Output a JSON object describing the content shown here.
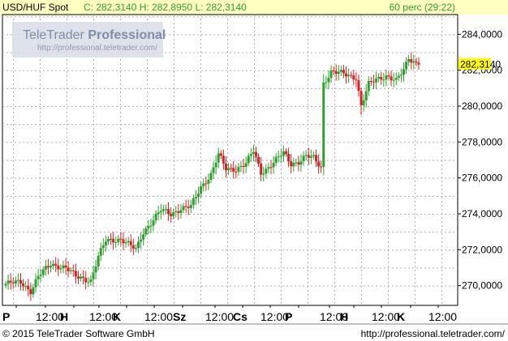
{
  "header": {
    "symbol": "USD/HUF Spot",
    "ohlc_text": "C: 282,3140 H: 282,8950 L: 282,3140",
    "interval": "60 perc (29:22)",
    "colors": {
      "background": "#ffffc0",
      "ohlc": "#2ea02e",
      "symbol": "#000000"
    }
  },
  "logo": {
    "name_plain": "TeleTrader",
    "name_bold": "Professional",
    "url": "http://professional.teletrader.com/"
  },
  "footer": {
    "copyright": "© 2015 TeleTrader Software GmbH",
    "url": "http://professional.teletrader.com/"
  },
  "chart_data": {
    "type": "candlestick",
    "title": "",
    "y_ticks": [
      "284,0000",
      "282,0000",
      "280,0000",
      "278,0000",
      "276,0000",
      "274,0000",
      "272,0000",
      "270,0000"
    ],
    "y_tick_values": [
      284,
      282,
      280,
      278,
      276,
      274,
      272,
      270
    ],
    "x_ticks": [
      "P",
      "12:00",
      "H",
      "12:00",
      "K",
      "12:00",
      "Sz",
      "12:00",
      "Cs",
      "12:00",
      "P",
      "12:00",
      "H",
      "12:00",
      "K",
      "12:00"
    ],
    "ylim": [
      268.9,
      285.1
    ],
    "last_price": 282.314,
    "last_price_label": "282,3140",
    "grid": true,
    "colors": {
      "up": "#2ea02e",
      "down": "#e02020",
      "last_price_bg": "#ffff00"
    },
    "anchors": [
      [
        0,
        270.1
      ],
      [
        6,
        270.2
      ],
      [
        10,
        269.7
      ],
      [
        13,
        270.5
      ],
      [
        18,
        271.2
      ],
      [
        24,
        271.0
      ],
      [
        28,
        270.5
      ],
      [
        34,
        270.3
      ],
      [
        37,
        271.6
      ],
      [
        40,
        272.5
      ],
      [
        46,
        272.6
      ],
      [
        48,
        272.4
      ],
      [
        52,
        272.0
      ],
      [
        55,
        273.0
      ],
      [
        58,
        273.5
      ],
      [
        62,
        274.2
      ],
      [
        66,
        274.0
      ],
      [
        70,
        274.3
      ],
      [
        74,
        274.4
      ],
      [
        78,
        275.5
      ],
      [
        82,
        276.2
      ],
      [
        85,
        277.3
      ],
      [
        88,
        276.5
      ],
      [
        92,
        276.5
      ],
      [
        96,
        276.8
      ],
      [
        99,
        277.5
      ],
      [
        102,
        276.3
      ],
      [
        105,
        276.6
      ],
      [
        108,
        277.0
      ],
      [
        111,
        277.4
      ],
      [
        114,
        276.8
      ],
      [
        117,
        276.9
      ],
      [
        120,
        277.2
      ],
      [
        123,
        277.1
      ],
      [
        126,
        276.6
      ],
      [
        127,
        281.3
      ],
      [
        130,
        281.9
      ],
      [
        135,
        281.8
      ],
      [
        140,
        281.6
      ],
      [
        142,
        280.0
      ],
      [
        145,
        281.2
      ],
      [
        148,
        281.5
      ],
      [
        152,
        281.7
      ],
      [
        156,
        281.4
      ],
      [
        159,
        282.0
      ],
      [
        161,
        282.7
      ],
      [
        163,
        282.5
      ],
      [
        165,
        282.314
      ]
    ]
  }
}
